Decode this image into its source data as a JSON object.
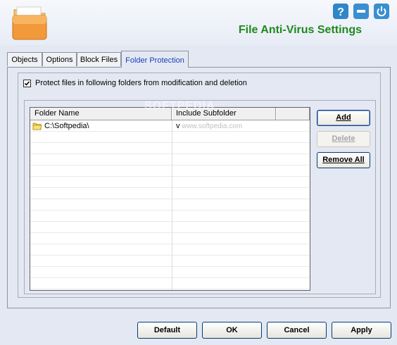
{
  "header": {
    "title": "File Anti-Virus Settings",
    "help_icon": "question-icon",
    "minimize_icon": "minimize-icon",
    "power_icon": "power-icon",
    "accent_color": "#1e8a1e"
  },
  "tabs": [
    {
      "label": "Objects",
      "active": false
    },
    {
      "label": "Options",
      "active": false
    },
    {
      "label": "Block Files",
      "active": false
    },
    {
      "label": "Folder Protection",
      "active": true
    }
  ],
  "protection": {
    "checkbox_label": "Protect files in following folders from modification and deletion",
    "checked": true
  },
  "folder_table": {
    "columns": [
      "Folder Name",
      "Include Subfolder",
      ""
    ],
    "rows": [
      {
        "folder": "C:\\Softpedia\\",
        "include_subfolder": "v"
      }
    ]
  },
  "side_buttons": {
    "add": "Add",
    "delete": "Delete",
    "remove_all": "Remove All",
    "delete_enabled": false
  },
  "footer_buttons": {
    "default": "Default",
    "ok": "OK",
    "cancel": "Cancel",
    "apply": "Apply"
  },
  "watermark": {
    "main": "SOFTPEDIA",
    "sub": "www.softpedia.com"
  }
}
